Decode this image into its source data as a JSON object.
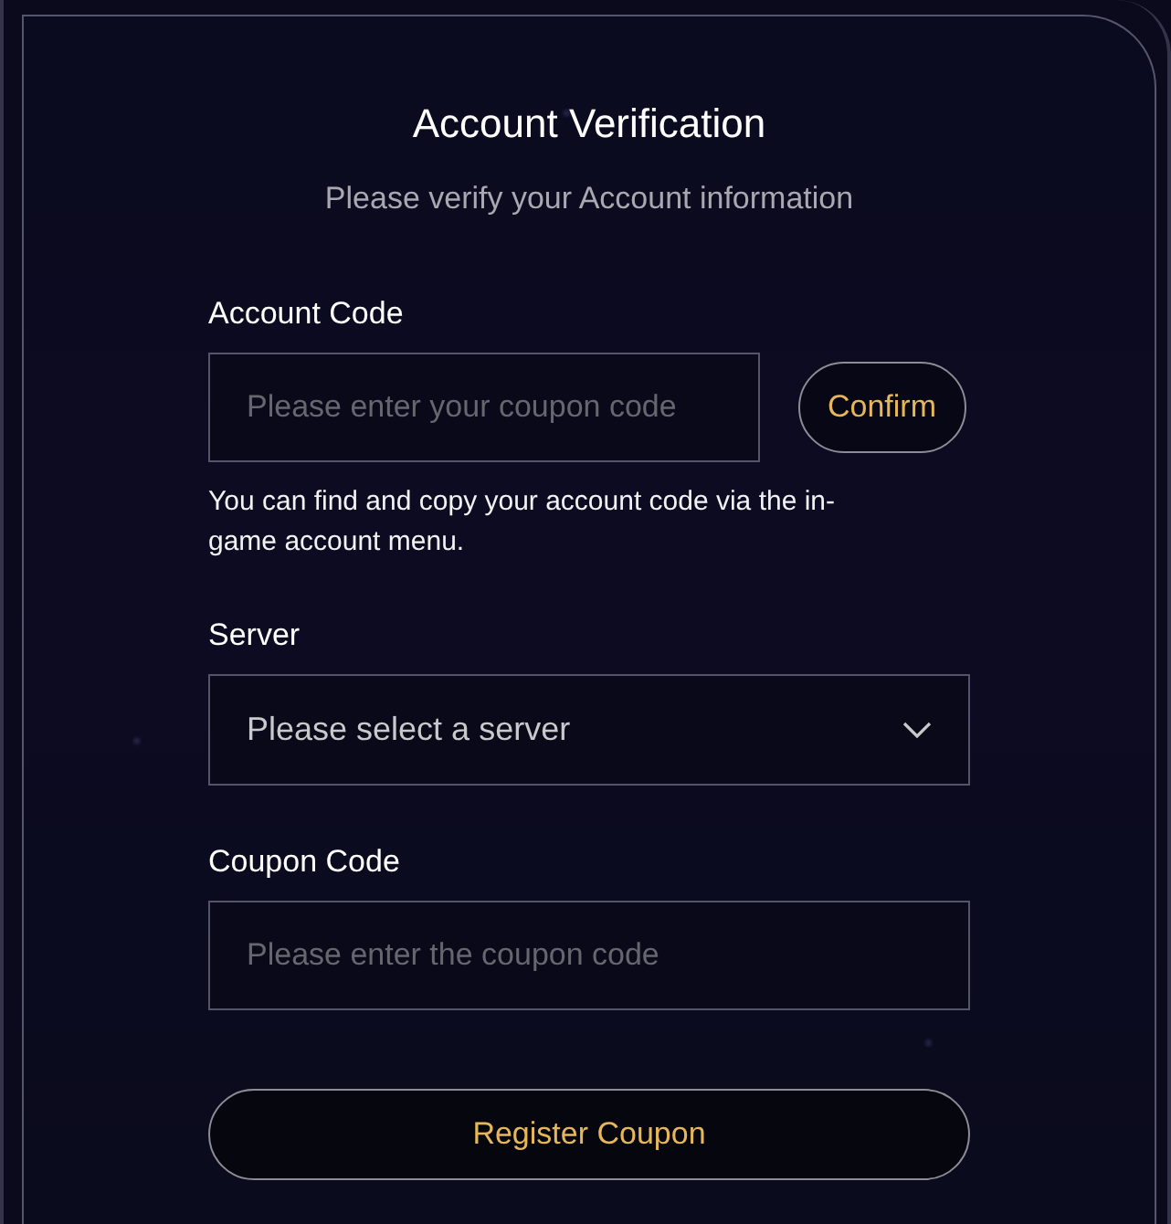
{
  "title": "Account Verification",
  "subtitle": "Please verify your Account information",
  "account_code": {
    "label": "Account Code",
    "placeholder": "Please enter your coupon code",
    "button": "Confirm",
    "help": "You can find and copy your account code via the in-game account menu."
  },
  "server": {
    "label": "Server",
    "placeholder": "Please select a server"
  },
  "coupon_code": {
    "label": "Coupon Code",
    "placeholder": "Please enter the coupon code"
  },
  "submit": "Register Coupon"
}
